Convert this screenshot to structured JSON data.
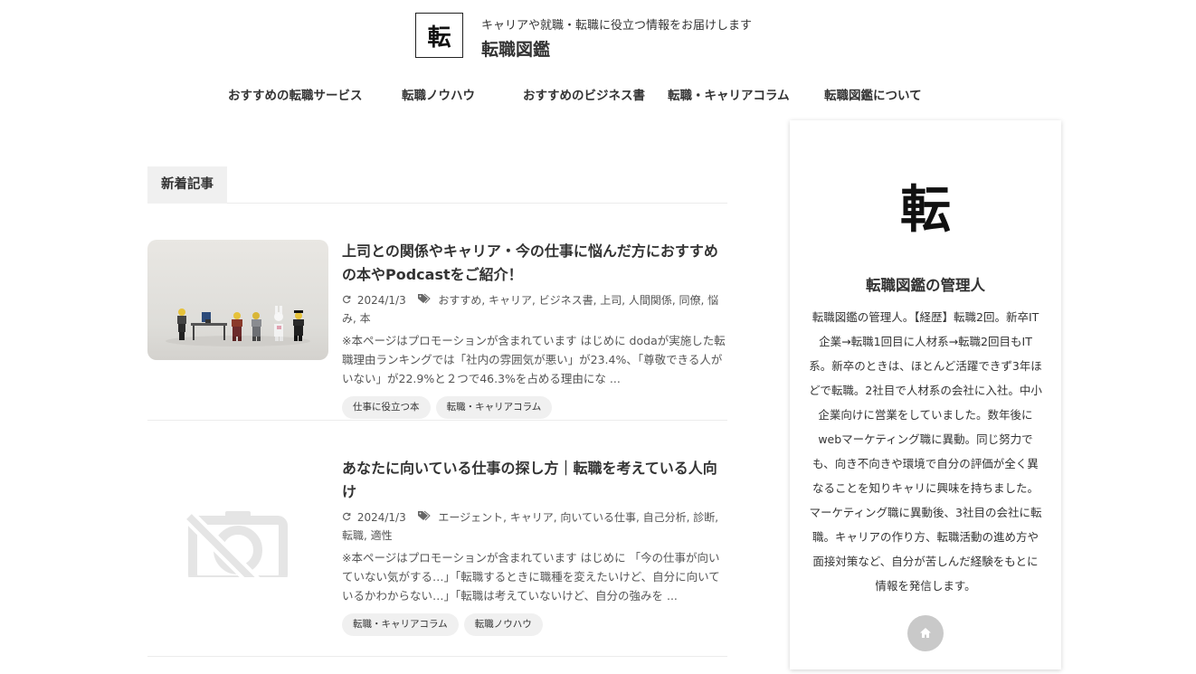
{
  "site": {
    "logo_char": "転",
    "tagline": "キャリアや就職・転職に役立つ情報をお届けします",
    "name": "転職図鑑"
  },
  "nav": {
    "items": [
      {
        "label": "おすすめの転職サービス"
      },
      {
        "label": "転職ノウハウ"
      },
      {
        "label": "おすすめのビジネス書"
      },
      {
        "label": "転職・キャリアコラム"
      },
      {
        "label": "転職図鑑について"
      }
    ]
  },
  "main": {
    "section_title": "新着記事",
    "articles": [
      {
        "title": "上司との関係やキャリア・今の仕事に悩んだ方におすすめの本やPodcastをご紹介！",
        "date": "2024/1/3",
        "tags": "おすすめ, キャリア, ビジネス書, 上司, 人間関係, 同僚, 悩み, 本",
        "excerpt": "※本ページはプロモーションが含まれています はじめに dodaが実施した転職理由ランキングでは「社内の雰囲気が悪い」が23.4%、「尊敬できる人がいない」が22.9%と２つで46.3%を占める理由にな ...",
        "categories": [
          "仕事に役立つ本",
          "転職・キャリアコラム"
        ]
      },
      {
        "title": "あなたに向いている仕事の探し方｜転職を考えている人向け",
        "date": "2024/1/3",
        "tags": "エージェント, キャリア, 向いている仕事, 自己分析, 診断, 転職, 適性",
        "excerpt": "※本ページはプロモーションが含まれています はじめに 「今の仕事が向いていない気がする…」「転職するときに職種を変えたいけど、自分に向いているかわからない…」「転職は考えていないけど、自分の強みを ...",
        "categories": [
          "転職・キャリアコラム",
          "転職ノウハウ"
        ]
      }
    ]
  },
  "sidebar": {
    "logo_char": "転",
    "profile_name": "転職図鑑の管理人",
    "profile_text": "転職図鑑の管理人。【経歴】転職2回。新卒IT企業→転職1回目に人材系→転職2回目もIT系。新卒のときは、ほとんど活躍できず3年ほどで転職。2社目で人材系の会社に入社。中小企業向けに営業をしていました。数年後にwebマーケティング職に異動。同じ努力でも、向き不向きや環境で自分の評価が全く異なることを知りキャリに興味を持ちました。マーケティング職に異動後、3社目の会社に転職。キャリアの作り方、転職活動の進め方や面接対策など、自分が苦しんだ経験をもとに情報を発信します。"
  },
  "icons": {
    "update": "refresh-icon",
    "tag": "tag-icon",
    "no_image": "no-image-icon",
    "home": "home-icon"
  },
  "colors": {
    "text": "#333333",
    "section_bg": "#f0f0f0",
    "home_button": "#c9c9c9"
  }
}
